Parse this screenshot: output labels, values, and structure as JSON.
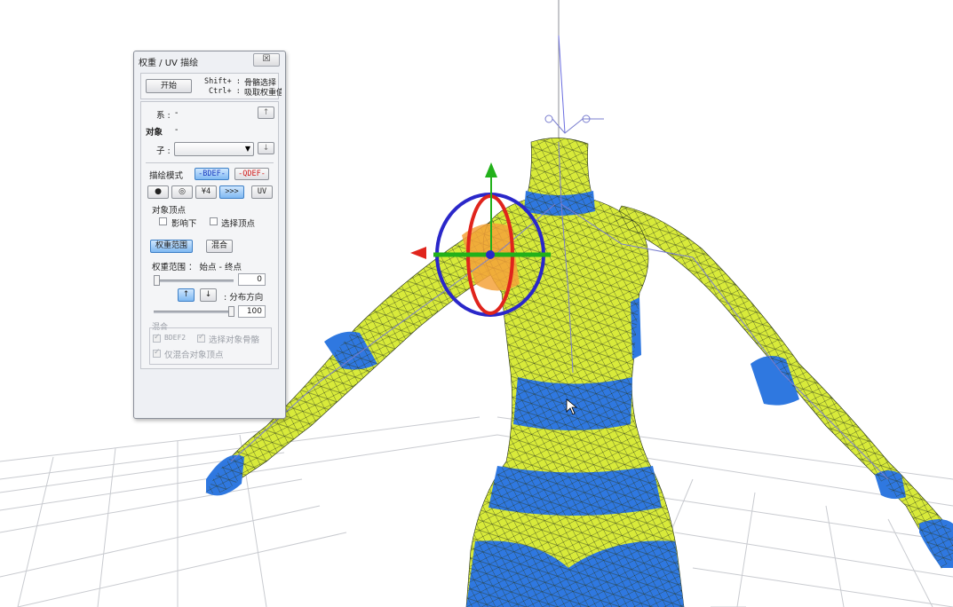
{
  "panel": {
    "title": "权重 / UV 描绘",
    "close_label": "☒",
    "start_button": "开始",
    "hints": [
      {
        "key": "Shift+ :",
        "text": "骨骼选择"
      },
      {
        "key": "Ctrl+ :",
        "text": "吸取权重值"
      }
    ],
    "bone_row": {
      "label": "系 :",
      "value": "-"
    },
    "target_row": {
      "label": "对象",
      "value": "-"
    },
    "child_row": {
      "label": "子 :",
      "value": ""
    },
    "paint_mode_label": "描绘模式",
    "bdef_label": "-BDEF-",
    "qdef_label": "-QDEF-",
    "mode_buttons": [
      "●",
      "◎",
      "¥4",
      ">>>",
      "UV"
    ],
    "target_vertices_label": "对象顶点",
    "check_influence": "影响下",
    "check_select_vertex": "选择顶点",
    "weight_range_button": "权重范围",
    "blend_button": "混合",
    "range_label": "权重范围 ： 始点 - 终点",
    "start_value": "0",
    "distribution_label": "分布方向",
    "end_value": "100",
    "blend_group_label": "混合",
    "check_bdef2": "BDEF2",
    "check_target_bone": "选择对象骨骼",
    "check_only_blend": "仅混合对象顶点"
  },
  "icons": {
    "up_arrow": "arrow-up-icon",
    "down_arrow": "arrow-down-icon",
    "dropdown": "chevron-down-icon"
  },
  "colors": {
    "mesh_yellow": "#d8ea3a",
    "mesh_blue": "#2f78e0",
    "gizmo_red": "#e0241c",
    "gizmo_green": "#22b11a",
    "gizmo_blue": "#2a27c9",
    "accent_blue": "#3d7fc6"
  }
}
